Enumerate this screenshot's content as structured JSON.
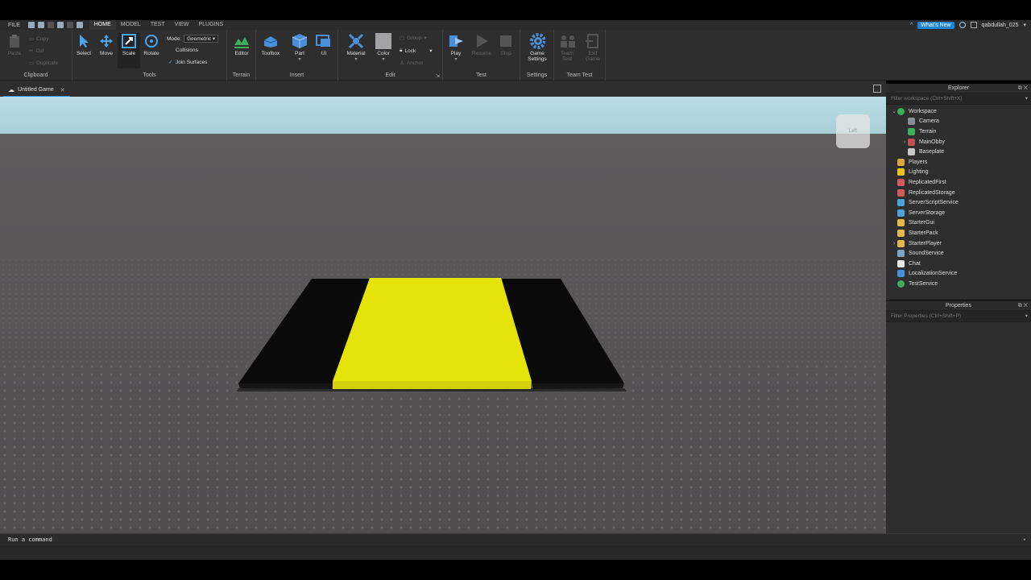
{
  "menubar": {
    "file": "FILE",
    "tabs": [
      "HOME",
      "MODEL",
      "TEST",
      "VIEW",
      "PLUGINS"
    ],
    "active_tab": "HOME",
    "whats_new": "What's New",
    "username": "qabdullah_025"
  },
  "ribbon": {
    "clipboard": {
      "label": "Clipboard",
      "paste": "Paste",
      "copy": "Copy",
      "cut": "Cut",
      "duplicate": "Duplicate"
    },
    "tools": {
      "label": "Tools",
      "select": "Select",
      "move": "Move",
      "scale": "Scale",
      "rotate": "Rotate",
      "mode_label": "Mode:",
      "mode_value": "Geometric",
      "collisions": "Collisions",
      "join_surfaces": "Join Surfaces"
    },
    "terrain": {
      "label": "Terrain",
      "editor": "Editor"
    },
    "insert": {
      "label": "Insert",
      "toolbox": "Toolbox",
      "part": "Part",
      "ui": "UI"
    },
    "edit": {
      "label": "Edit",
      "material": "Material",
      "color": "Color",
      "group": "Group",
      "lock": "Lock",
      "anchor": "Anchor"
    },
    "test": {
      "label": "Test",
      "play": "Play",
      "resume": "Resume",
      "stop": "Stop"
    },
    "settings": {
      "label": "Settings",
      "game_settings_1": "Game",
      "game_settings_2": "Settings"
    },
    "team_test": {
      "label": "Team Test",
      "team_test_1": "Team",
      "team_test_2": "Test",
      "exit_game_1": "Exit",
      "exit_game_2": "Game"
    }
  },
  "document_tab": {
    "label": "Untitled Game"
  },
  "viewport": {
    "viewcube_face": "Left"
  },
  "explorer": {
    "title": "Explorer",
    "filter_placeholder": "Filter workspace (Ctrl+Shift+X)",
    "items": [
      {
        "label": "Workspace",
        "depth": 0,
        "arrow": "open",
        "icon": "globe-icon",
        "color": "#3fae5a"
      },
      {
        "label": "Camera",
        "depth": 1,
        "arrow": "none",
        "icon": "camera-icon",
        "color": "#8a8f96"
      },
      {
        "label": "Terrain",
        "depth": 1,
        "arrow": "none",
        "icon": "terrain-icon",
        "color": "#3fae5a"
      },
      {
        "label": "MainObby",
        "depth": 1,
        "arrow": "closed",
        "icon": "model-icon",
        "color": "#c05050"
      },
      {
        "label": "Baseplate",
        "depth": 1,
        "arrow": "none",
        "icon": "part-icon",
        "color": "#c7c7c7"
      },
      {
        "label": "Players",
        "depth": 0,
        "arrow": "none",
        "icon": "players-icon",
        "color": "#d9a43a"
      },
      {
        "label": "Lighting",
        "depth": 0,
        "arrow": "none",
        "icon": "lightbulb-icon",
        "color": "#f0c419"
      },
      {
        "label": "ReplicatedFirst",
        "depth": 0,
        "arrow": "none",
        "icon": "replicated-first-icon",
        "color": "#d35b5b"
      },
      {
        "label": "ReplicatedStorage",
        "depth": 0,
        "arrow": "none",
        "icon": "replicated-storage-icon",
        "color": "#d35b5b"
      },
      {
        "label": "ServerScriptService",
        "depth": 0,
        "arrow": "none",
        "icon": "server-script-service-icon",
        "color": "#4aa3d9"
      },
      {
        "label": "ServerStorage",
        "depth": 0,
        "arrow": "none",
        "icon": "server-storage-icon",
        "color": "#4aa3d9"
      },
      {
        "label": "StarterGui",
        "depth": 0,
        "arrow": "none",
        "icon": "folder-icon",
        "color": "#e6b84a"
      },
      {
        "label": "StarterPack",
        "depth": 0,
        "arrow": "none",
        "icon": "folder-icon",
        "color": "#e6b84a"
      },
      {
        "label": "StarterPlayer",
        "depth": 0,
        "arrow": "closed",
        "icon": "starter-player-icon",
        "color": "#e6b84a"
      },
      {
        "label": "SoundService",
        "depth": 0,
        "arrow": "none",
        "icon": "sound-icon",
        "color": "#7aa7c9"
      },
      {
        "label": "Chat",
        "depth": 0,
        "arrow": "none",
        "icon": "chat-icon",
        "color": "#e8e8e8"
      },
      {
        "label": "LocalizationService",
        "depth": 0,
        "arrow": "none",
        "icon": "localization-icon",
        "color": "#4a8fd9"
      },
      {
        "label": "TestService",
        "depth": 0,
        "arrow": "none",
        "icon": "check-icon",
        "color": "#3fae5a"
      }
    ]
  },
  "properties": {
    "title": "Properties",
    "filter_placeholder": "Filter Properties (Ctrl+Shift+P)"
  },
  "command_bar": {
    "placeholder": "Run a command"
  },
  "colors": {
    "accent": "#1f86d6",
    "obby_yellow": "#e5e40a",
    "obby_black": "#0a0a0a",
    "sky": "#b9dde3",
    "baseplate": "#5d5b5c"
  }
}
